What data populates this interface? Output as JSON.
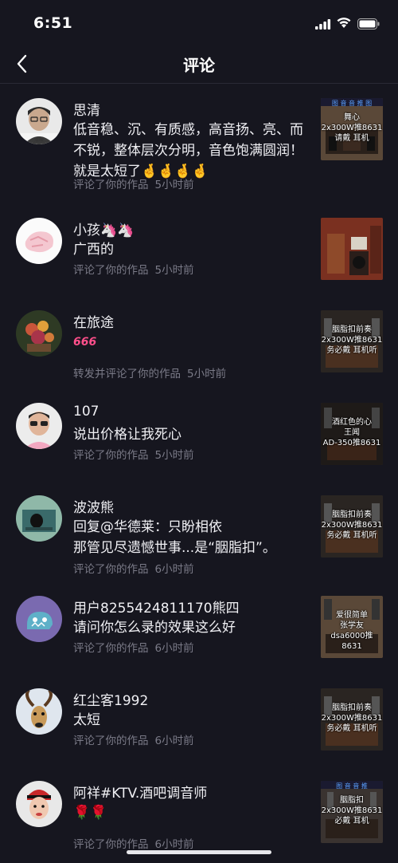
{
  "status": {
    "time": "6:51"
  },
  "header": {
    "title": "评论"
  },
  "comments": [
    {
      "name": "思清",
      "text": "低音稳、沉、有质感，高音扬、亮、而不锐，整体层次分明，音色饱满圆润！就是太短了🤞🤞🤞🤞",
      "action": "评论了你的作品",
      "time": "5小时前",
      "avatar_label": "温暖",
      "thumb_top": "图 音 音 推 图",
      "thumb_text": [
        "舞心",
        "2x300W推8631",
        "请戴 耳机"
      ]
    },
    {
      "name": "小孩🦄🦄",
      "text": "广西的",
      "action": "评论了你的作品",
      "time": "5小时前",
      "thumb_top": "",
      "thumb_text": []
    },
    {
      "name": "在旅途",
      "text": "666",
      "action": "转发并评论了你的作品",
      "time": "5小时前",
      "thumb_top": "",
      "thumb_text": [
        "胭脂扣前奏",
        "2x300W推8631",
        "务必戴 耳机听"
      ]
    },
    {
      "name": "107",
      "text": "说出价格让我死心",
      "action": "评论了你的作品",
      "time": "5小时前",
      "thumb_top": "",
      "thumb_text": [
        "酒红色的心",
        "王闻",
        "AD-350推8631"
      ]
    },
    {
      "name": "波波熊",
      "text": "回复@华德莱：只盼相依\n那管见尽遗憾世事...是“胭脂扣”。",
      "action": "评论了你的作品",
      "time": "6小时前",
      "thumb_top": "",
      "thumb_text": [
        "胭脂扣前奏",
        "2x300W推8631",
        "务必戴 耳机听"
      ]
    },
    {
      "name": "用户8255424811170熊四",
      "text": "请问你怎么录的效果这么好",
      "action": "评论了你的作品",
      "time": "6小时前",
      "thumb_top": "",
      "thumb_text": [
        "爱很简单",
        "张学友",
        "dsa6000推8631"
      ]
    },
    {
      "name": "红尘客1992",
      "text": "太短",
      "action": "评论了你的作品",
      "time": "6小时前",
      "thumb_top": "",
      "thumb_text": [
        "胭脂扣前奏",
        "2x300W推8631",
        "务必戴 耳机听"
      ]
    },
    {
      "name": "阿祥#KTV.酒吧调音师",
      "text": "🌹🌹",
      "action": "评论了你的作品",
      "time": "6小时前",
      "thumb_top": "图 音 音 推",
      "thumb_text": [
        "胭脂扣",
        "2x300W推8631",
        "必戴 耳机"
      ]
    }
  ],
  "colors": {
    "background": "#16161f",
    "meta_text": "#7b7b88",
    "divider": "#2a2a36"
  },
  "icons": [
    "signal-icon",
    "wifi-icon",
    "battery-icon",
    "back-arrow-icon"
  ]
}
